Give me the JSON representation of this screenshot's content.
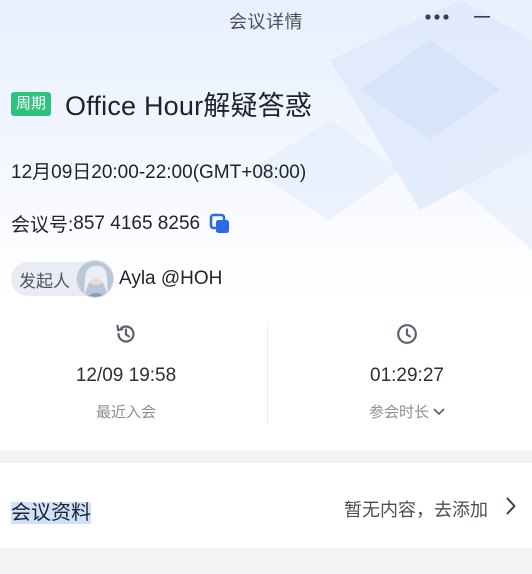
{
  "window": {
    "title": "会议详情"
  },
  "meeting": {
    "tag": "周期",
    "title": "Office Hour解疑答惑",
    "time": "12月09日20:00-22:00(GMT+08:00)",
    "id_label": "会议号:",
    "id_value": "857 4165 8256"
  },
  "host": {
    "label": "发起人",
    "name": "Ayla @HOH"
  },
  "stats": {
    "last_join": {
      "value": "12/09 19:58",
      "label": "最近入会"
    },
    "duration": {
      "value": "01:29:27",
      "label": "参会时长"
    }
  },
  "docs": {
    "title": "会议资料",
    "hint": "暂无内容，去添加"
  },
  "colors": {
    "tag_green": "#2ec27e",
    "copy_blue": "#2a6ce8",
    "band_gray": "#f2f3f5"
  }
}
